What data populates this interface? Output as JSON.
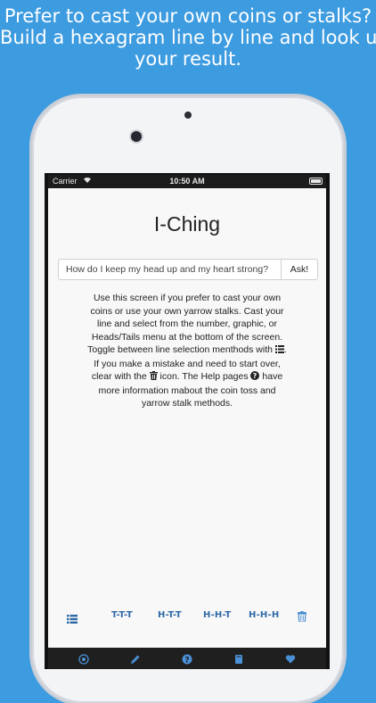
{
  "promo": {
    "line1": "Prefer to cast your own coins or stalks?",
    "line2": "Build a hexagram line by line and look up",
    "line3": "your result."
  },
  "statusbar": {
    "carrier": "Carrier",
    "time": "10:50 AM"
  },
  "app": {
    "title": "I-Ching"
  },
  "question": {
    "value": "How do I keep my head up and my heart strong?",
    "ask_label": "Ask!"
  },
  "instructions": {
    "part1": "Use this screen if you prefer to cast your own coins or use your own yarrow stalks. Cast your line and select from the number, graphic, or Heads/Tails menu at the bottom of the screen. Toggle between line selection menthods with ",
    "part2": ". If you make a mistake and need to start over, clear with the ",
    "part3": " icon. The Help pages ",
    "part4": " have more information mabout the coin toss and yarrow stalk methods."
  },
  "methods": [
    "T-T-T",
    "H-T-T",
    "H-H-T",
    "H-H-H"
  ],
  "icons": {
    "list": "list-icon",
    "trash": "trash-icon",
    "help": "help-icon",
    "tabs": [
      "target-icon",
      "pencil-icon",
      "help-icon",
      "book-icon",
      "heart-icon"
    ]
  },
  "colors": {
    "background": "#3d9be0",
    "accent": "#2f6aa6",
    "tabbar": "#1f1f1f",
    "tab_icon": "#4a90d6"
  }
}
